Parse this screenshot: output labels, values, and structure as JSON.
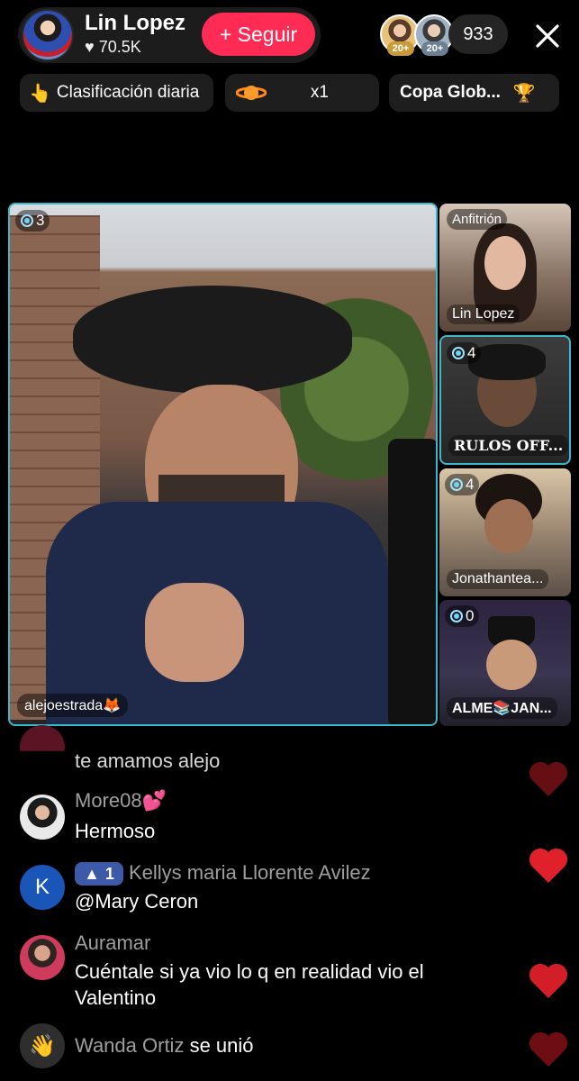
{
  "header": {
    "host_name": "Lin Lopez",
    "likes": "70.5K",
    "follow_label": "+ Seguir",
    "viewer_badges": [
      "20+",
      "20+"
    ],
    "viewer_count": "933"
  },
  "pills": {
    "daily_rank": "Clasificación diaria",
    "multiplier": "x1",
    "cup": "Copa Glob..."
  },
  "main_video": {
    "count": "3",
    "username": "alejoestrada🦊"
  },
  "side_videos": [
    {
      "tag": "Anfitrión",
      "name": "Lin Lopez"
    },
    {
      "count": "4",
      "name": "RULOS OFF..."
    },
    {
      "count": "4",
      "name": "Jonathantea..."
    },
    {
      "count": "0",
      "name": "ALME📚JAN..."
    }
  ],
  "chat": [
    {
      "text": "te amamos alejo"
    },
    {
      "user": "More08💕",
      "text": "Hermoso"
    },
    {
      "level": "1",
      "user": "Kellys maria Llorente Avilez",
      "text": "@Mary Ceron",
      "avatar_letter": "K"
    },
    {
      "user": "Auramar",
      "text": "Cuéntale si ya vio lo q en realidad vio el Valentino"
    },
    {
      "user": "Wanda Ortiz",
      "text": "se unió"
    }
  ],
  "colors": {
    "follow": "#fe2c55",
    "active_border": "#3bb9cc",
    "heart": "#e0202a"
  }
}
